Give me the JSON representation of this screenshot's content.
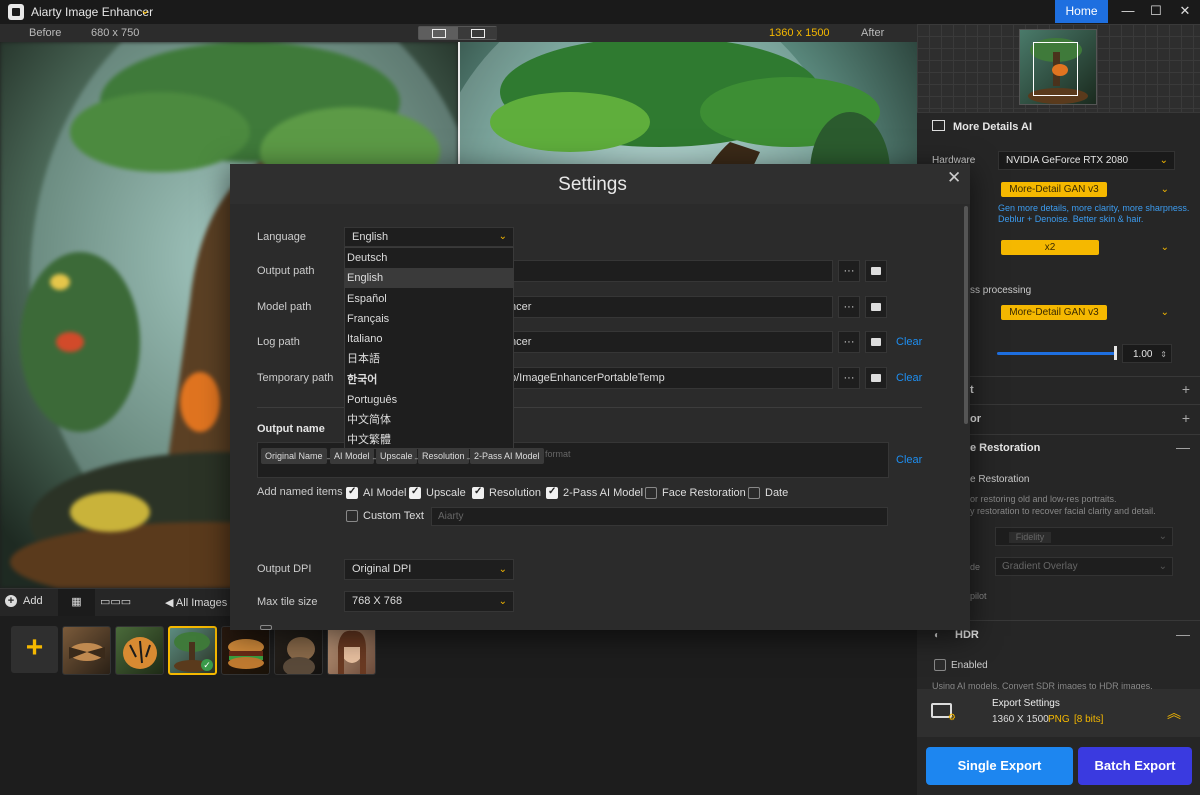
{
  "app": {
    "title": "Aiarty Image Enhancer",
    "home_label": "Home",
    "window_controls": [
      "minimize-icon",
      "maximize-icon",
      "close-icon"
    ]
  },
  "preview": {
    "before_label": "Before",
    "before_res": "680 x 750",
    "after_res": "1360 x 1500",
    "after_label": "After"
  },
  "thumbs_toolbar": {
    "add_label": "Add",
    "all_images_label": "All Images"
  },
  "right_panel": {
    "model_section_title": "More Details AI",
    "hardware_label": "Hardware",
    "hardware_value": "NVIDIA GeForce RTX 2080",
    "model_value": "More-Detail GAN  v3",
    "model_desc_line1": "Gen more details, more clarity, more sharpness.",
    "model_desc_line2": "Deblur + Denoise. Better skin & hair.",
    "scale_value": "x2",
    "second_pass_label": "ss processing",
    "second_model_value": "More-Detail GAN  v3",
    "strength_value": "1.00",
    "section_a_label": "t",
    "section_b_label": "or",
    "face_section_label": "e Restoration",
    "face_enable_label": "e Restoration",
    "face_desc_line1": "or restoring old and low-res portraits.",
    "face_desc_line2": "y restoration to recover facial clarity and detail.",
    "fidelity_label": "Fidelity",
    "mode_label": "de",
    "mode_value": "Gradient Overlay",
    "pilot_label": "pilot",
    "hdr_title": "HDR",
    "hdr_enabled_label": "Enabled",
    "hdr_desc": "Using AI models. Convert SDR images to HDR images.",
    "export_title": "Export Settings",
    "export_res": "1360 X 1500",
    "export_format": "PNG",
    "export_bits": "[8 bits]",
    "single_export": "Single Export",
    "batch_export": "Batch Export",
    "colors": {
      "accent": "#f5b800",
      "primary": "#1d86f0",
      "batch": "#3a3ae0"
    }
  },
  "settings": {
    "title": "Settings",
    "language_label": "Language",
    "language_value": "English",
    "output_path_label": "Output path",
    "model_path_label": "Model path",
    "model_path_value": "ncer",
    "log_path_label": "Log path",
    "log_path_value": "ncer",
    "temp_path_label": "Temporary path",
    "temp_path_value": "p/ImageEnhancerPortableTemp",
    "browse_label": "···",
    "clear_label": "Clear",
    "output_name_label": "Output name",
    "tokens": [
      "Original Name",
      "AI Model",
      "Upscale",
      "Resolution",
      "2-Pass AI Model"
    ],
    "token_sep": "_",
    "token_format": "format",
    "add_named_items_label": "Add named items",
    "named_items": [
      {
        "label": "AI Model",
        "checked": true
      },
      {
        "label": "Upscale",
        "checked": true
      },
      {
        "label": "Resolution",
        "checked": true
      },
      {
        "label": "2-Pass AI Model",
        "checked": true
      },
      {
        "label": "Face Restoration",
        "checked": false
      },
      {
        "label": "Date",
        "checked": false
      }
    ],
    "custom_text_label": "Custom Text",
    "custom_text_placeholder": "Aiarty",
    "output_dpi_label": "Output DPI",
    "output_dpi_value": "Original DPI",
    "max_tile_label": "Max tile size",
    "max_tile_value": "768 X 768",
    "language_options": [
      "Deutsch",
      "English",
      "Español",
      "Français",
      "Italiano",
      "日本語",
      "한국어",
      "Português",
      "中文简体",
      "中文繁體"
    ],
    "language_hover": "English"
  }
}
